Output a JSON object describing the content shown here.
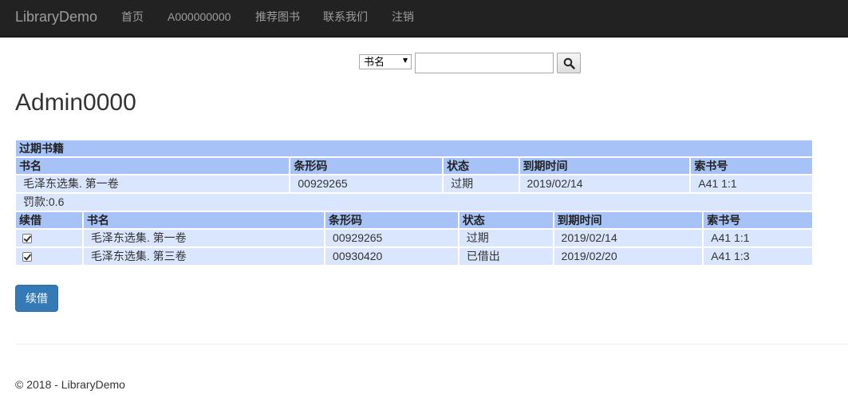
{
  "navbar": {
    "brand": "LibraryDemo",
    "links": [
      "首页",
      "A000000000",
      "推荐图书",
      "联系我们",
      "注销"
    ]
  },
  "search": {
    "select_value": "书名",
    "input_value": "",
    "button_icon": "search-icon"
  },
  "page_title": "Admin0000",
  "overdue_table": {
    "caption": "过期书籍",
    "headers": [
      "书名",
      "条形码",
      "状态",
      "到期时间",
      "索书号"
    ],
    "rows": [
      [
        "毛泽东选集. 第一卷",
        "00929265",
        "过期",
        "2019/02/14",
        "A41 1:1"
      ]
    ],
    "fine": "罚款:0.6"
  },
  "borrow_table": {
    "headers": [
      "续借",
      "书名",
      "条形码",
      "状态",
      "到期时间",
      "索书号"
    ],
    "rows": [
      {
        "checked": true,
        "cells": [
          "毛泽东选集. 第一卷",
          "00929265",
          "过期",
          "2019/02/14",
          "A41 1:1"
        ]
      },
      {
        "checked": true,
        "cells": [
          "毛泽东选集. 第三卷",
          "00930420",
          "已借出",
          "2019/02/20",
          "A41 1:3"
        ]
      }
    ]
  },
  "renew_button": "续借",
  "footer": "© 2018 - LibraryDemo",
  "colors": {
    "navbar_bg": "#222222",
    "header_cell": "#a6c2f7",
    "body_cell": "#dae6fd",
    "primary_button": "#337ab7"
  }
}
